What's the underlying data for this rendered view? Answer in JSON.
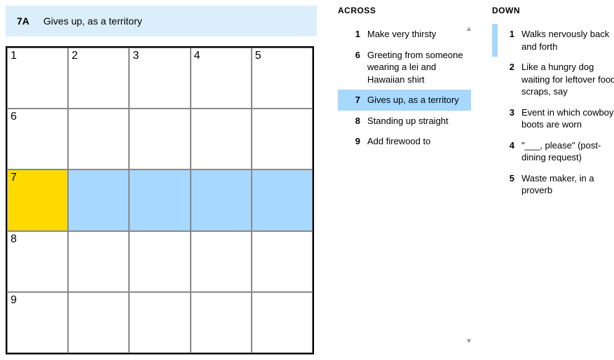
{
  "current_clue": {
    "label": "7A",
    "text": "Gives up, as a territory"
  },
  "grid": {
    "rows": 5,
    "cols": 5,
    "cells": [
      {
        "r": 0,
        "c": 0,
        "num": "1",
        "state": "normal"
      },
      {
        "r": 0,
        "c": 1,
        "num": "2",
        "state": "normal"
      },
      {
        "r": 0,
        "c": 2,
        "num": "3",
        "state": "normal"
      },
      {
        "r": 0,
        "c": 3,
        "num": "4",
        "state": "normal"
      },
      {
        "r": 0,
        "c": 4,
        "num": "5",
        "state": "normal"
      },
      {
        "r": 1,
        "c": 0,
        "num": "6",
        "state": "normal"
      },
      {
        "r": 1,
        "c": 1,
        "num": "",
        "state": "normal"
      },
      {
        "r": 1,
        "c": 2,
        "num": "",
        "state": "normal"
      },
      {
        "r": 1,
        "c": 3,
        "num": "",
        "state": "normal"
      },
      {
        "r": 1,
        "c": 4,
        "num": "",
        "state": "normal"
      },
      {
        "r": 2,
        "c": 0,
        "num": "7",
        "state": "focus"
      },
      {
        "r": 2,
        "c": 1,
        "num": "",
        "state": "highlight"
      },
      {
        "r": 2,
        "c": 2,
        "num": "",
        "state": "highlight"
      },
      {
        "r": 2,
        "c": 3,
        "num": "",
        "state": "highlight"
      },
      {
        "r": 2,
        "c": 4,
        "num": "",
        "state": "highlight"
      },
      {
        "r": 3,
        "c": 0,
        "num": "8",
        "state": "normal"
      },
      {
        "r": 3,
        "c": 1,
        "num": "",
        "state": "normal"
      },
      {
        "r": 3,
        "c": 2,
        "num": "",
        "state": "normal"
      },
      {
        "r": 3,
        "c": 3,
        "num": "",
        "state": "normal"
      },
      {
        "r": 3,
        "c": 4,
        "num": "",
        "state": "normal"
      },
      {
        "r": 4,
        "c": 0,
        "num": "9",
        "state": "normal"
      },
      {
        "r": 4,
        "c": 1,
        "num": "",
        "state": "normal"
      },
      {
        "r": 4,
        "c": 2,
        "num": "",
        "state": "normal"
      },
      {
        "r": 4,
        "c": 3,
        "num": "",
        "state": "normal"
      },
      {
        "r": 4,
        "c": 4,
        "num": "",
        "state": "normal"
      }
    ]
  },
  "across": {
    "title": "ACROSS",
    "clues": [
      {
        "num": "1",
        "text": "Make very thirsty",
        "state": ""
      },
      {
        "num": "6",
        "text": "Greeting from someone wearing a lei and Hawaiian shirt",
        "state": ""
      },
      {
        "num": "7",
        "text": "Gives up, as a territory",
        "state": "selected"
      },
      {
        "num": "8",
        "text": "Standing up straight",
        "state": ""
      },
      {
        "num": "9",
        "text": "Add firewood to",
        "state": ""
      }
    ]
  },
  "down": {
    "title": "DOWN",
    "clues": [
      {
        "num": "1",
        "text": "Walks nervously back and forth",
        "state": "related"
      },
      {
        "num": "2",
        "text": "Like a hungry dog waiting for leftover food scraps, say",
        "state": ""
      },
      {
        "num": "3",
        "text": "Event in which cowboy boots are worn",
        "state": ""
      },
      {
        "num": "4",
        "text": "\"___, please\" (post-dining request)",
        "state": ""
      },
      {
        "num": "5",
        "text": "Waste maker, in a proverb",
        "state": ""
      }
    ]
  }
}
